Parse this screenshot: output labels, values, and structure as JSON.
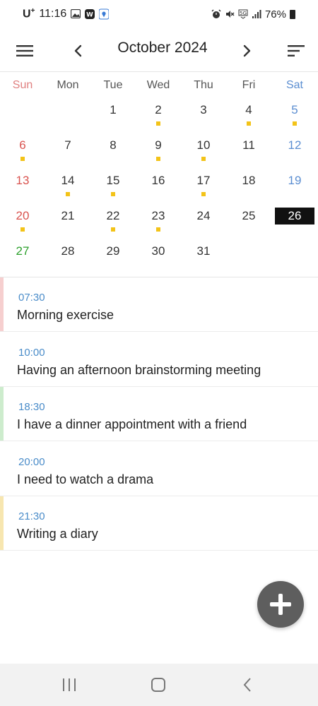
{
  "status_bar": {
    "carrier": "U",
    "carrier_sup": "+",
    "time": "11:16",
    "battery_text": "76%"
  },
  "header": {
    "month_title": "October 2024",
    "menu_icon": "hamburger-menu-icon",
    "prev_icon": "chevron-left-icon",
    "next_icon": "chevron-right-icon",
    "sort_icon": "sort-lines-icon"
  },
  "calendar": {
    "weekdays": [
      "Sun",
      "Mon",
      "Tue",
      "Wed",
      "Thu",
      "Fri",
      "Sat"
    ],
    "weeks": [
      [
        {
          "day": "",
          "dot": false
        },
        {
          "day": "",
          "dot": false
        },
        {
          "day": "1",
          "dot": false
        },
        {
          "day": "2",
          "dot": true
        },
        {
          "day": "3",
          "dot": false
        },
        {
          "day": "4",
          "dot": true
        },
        {
          "day": "5",
          "dot": true
        }
      ],
      [
        {
          "day": "6",
          "dot": true
        },
        {
          "day": "7",
          "dot": false
        },
        {
          "day": "8",
          "dot": false
        },
        {
          "day": "9",
          "dot": true
        },
        {
          "day": "10",
          "dot": true
        },
        {
          "day": "11",
          "dot": false
        },
        {
          "day": "12",
          "dot": false
        }
      ],
      [
        {
          "day": "13",
          "dot": false
        },
        {
          "day": "14",
          "dot": true
        },
        {
          "day": "15",
          "dot": true
        },
        {
          "day": "16",
          "dot": false
        },
        {
          "day": "17",
          "dot": true
        },
        {
          "day": "18",
          "dot": false
        },
        {
          "day": "19",
          "dot": false
        }
      ],
      [
        {
          "day": "20",
          "dot": true
        },
        {
          "day": "21",
          "dot": false
        },
        {
          "day": "22",
          "dot": true
        },
        {
          "day": "23",
          "dot": true
        },
        {
          "day": "24",
          "dot": false
        },
        {
          "day": "25",
          "dot": false
        },
        {
          "day": "26",
          "dot": false,
          "selected": true
        }
      ],
      [
        {
          "day": "27",
          "dot": false,
          "holiday": true
        },
        {
          "day": "28",
          "dot": false
        },
        {
          "day": "29",
          "dot": false
        },
        {
          "day": "30",
          "dot": false
        },
        {
          "day": "31",
          "dot": false
        },
        {
          "day": "",
          "dot": false
        },
        {
          "day": "",
          "dot": false
        }
      ]
    ],
    "dot_color": "#f3c318",
    "selected_bg": "#111111"
  },
  "events": [
    {
      "time": "07:30",
      "title": "Morning exercise",
      "color": "#f6cfcf"
    },
    {
      "time": "10:00",
      "title": "Having an afternoon brainstorming meeting",
      "color": ""
    },
    {
      "time": "18:30",
      "title": "I have a dinner appointment with a friend",
      "color": "#cdeccd"
    },
    {
      "time": "20:00",
      "title": "I need to watch a drama",
      "color": ""
    },
    {
      "time": "21:30",
      "title": "Writing a diary",
      "color": "#f7e6b0"
    }
  ],
  "fab": {
    "icon": "plus-icon",
    "color": "#5e5e5e"
  },
  "nav_bar": {
    "recents_icon": "recents-icon",
    "home_icon": "home-icon",
    "back_icon": "back-icon"
  }
}
